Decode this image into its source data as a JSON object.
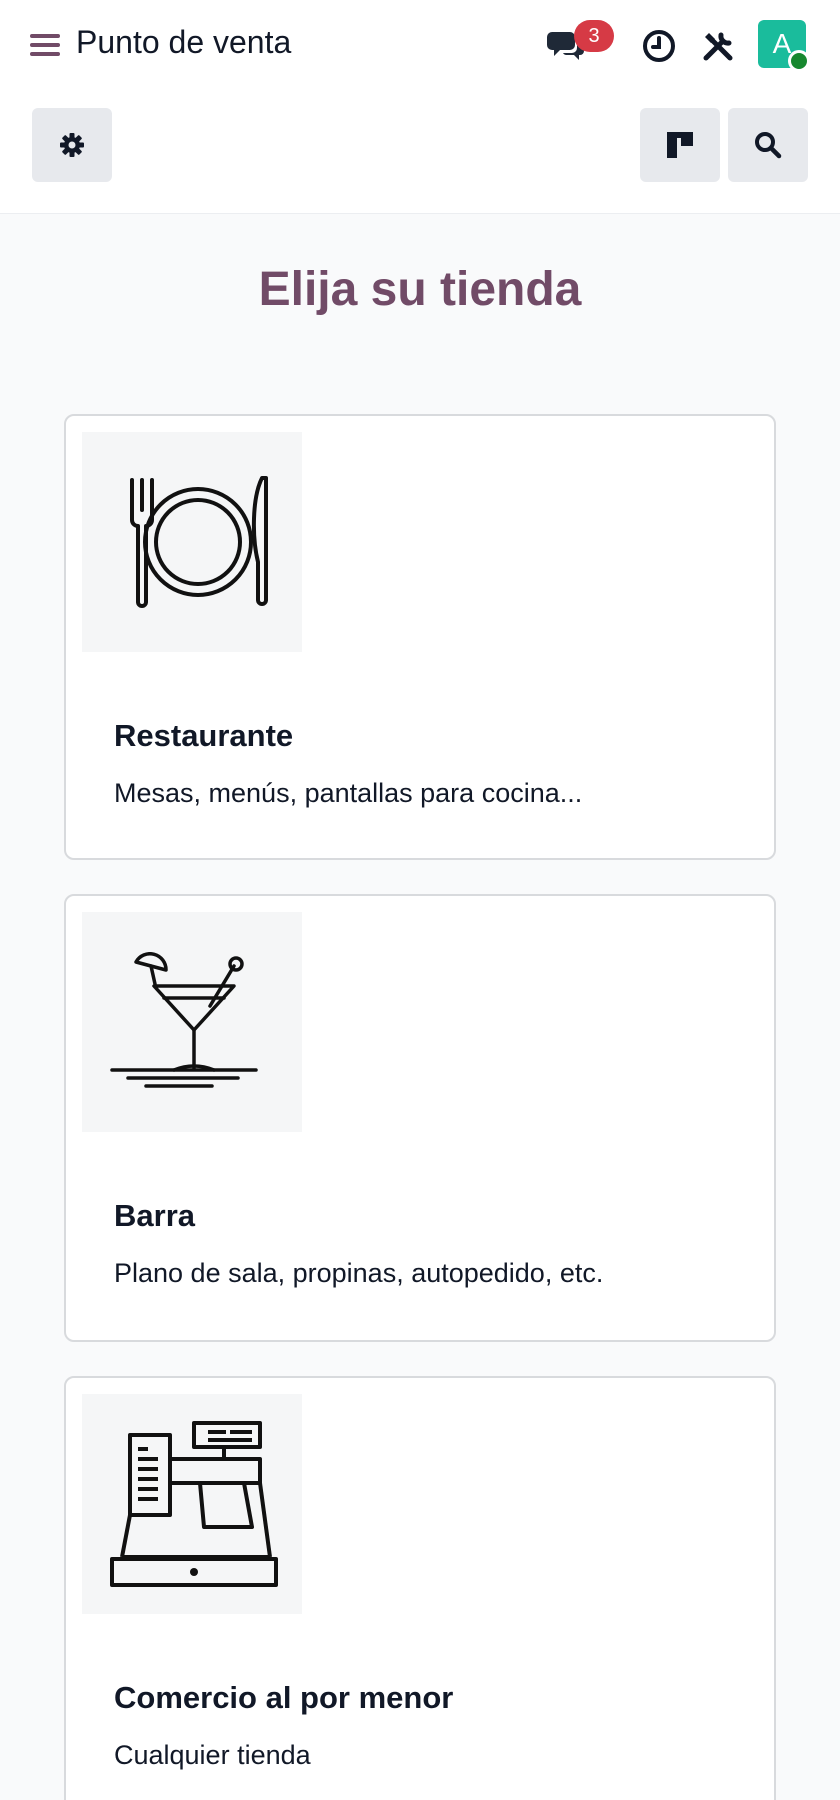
{
  "navbar": {
    "title": "Punto de venta",
    "menu_icon": "hamburger-menu-icon",
    "messages_badge": "3",
    "avatar_letter": "A"
  },
  "main": {
    "heading": "Elija su tienda"
  },
  "cards": [
    {
      "title": "Restaurante",
      "description": "Mesas, menús, pantallas para cocina...",
      "icon": "plate-cutlery-icon"
    },
    {
      "title": "Barra",
      "description": "Plano de sala, propinas, autopedido, etc.",
      "icon": "cocktail-icon"
    },
    {
      "title": "Comercio al por menor",
      "description": "Cualquier tienda",
      "icon": "cash-register-icon"
    }
  ],
  "colors": {
    "brand": "#714b67",
    "badge": "#d63a45",
    "avatar": "#1abc9c",
    "status_online": "#17882f"
  }
}
